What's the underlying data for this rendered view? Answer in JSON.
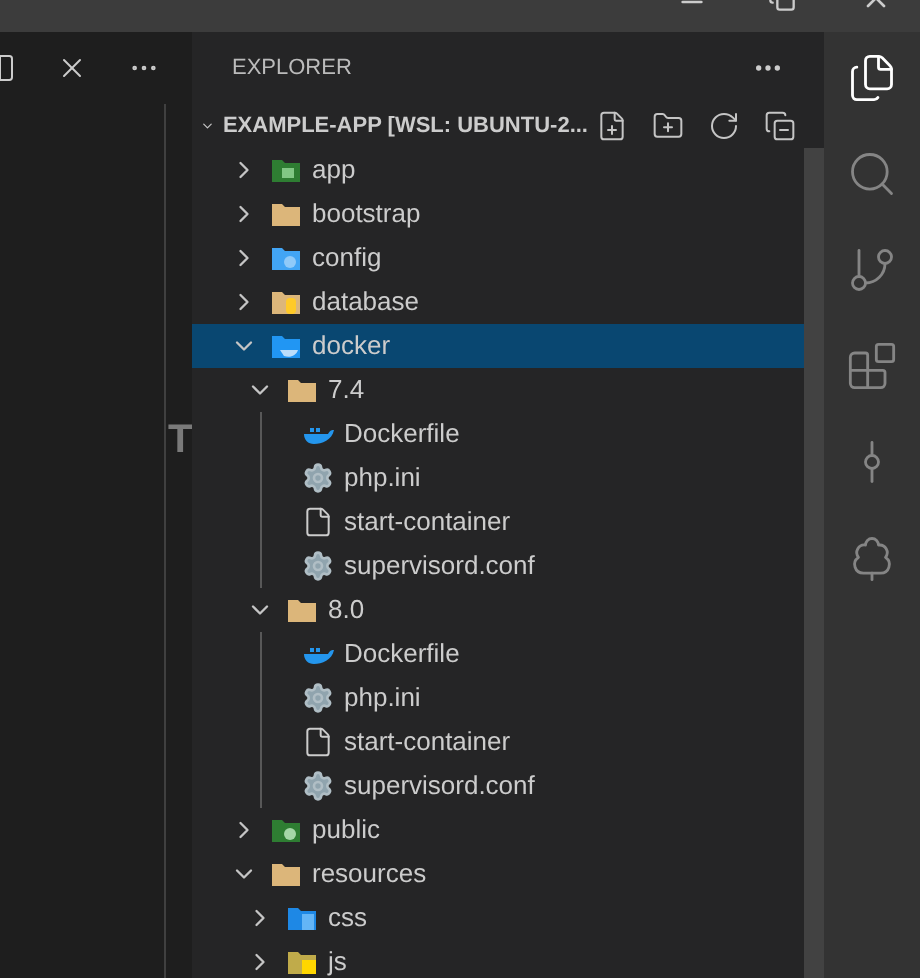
{
  "editor_fragment": "T",
  "explorer": {
    "title": "EXPLORER",
    "root": {
      "label": "EXAMPLE-APP [WSL: UBUNTU-2...",
      "expanded": true
    },
    "tree": [
      {
        "label": "app",
        "kind": "app-folder",
        "expanded": false,
        "selected": false
      },
      {
        "label": "bootstrap",
        "kind": "folder",
        "expanded": false,
        "selected": false
      },
      {
        "label": "config",
        "kind": "config-folder",
        "expanded": false,
        "selected": false
      },
      {
        "label": "database",
        "kind": "database-folder",
        "expanded": false,
        "selected": false
      },
      {
        "label": "docker",
        "kind": "docker-folder",
        "expanded": true,
        "selected": true,
        "children": [
          {
            "label": "7.4",
            "kind": "folder",
            "expanded": true,
            "selected": false,
            "children": [
              {
                "label": "Dockerfile",
                "kind": "docker-file",
                "selected": false
              },
              {
                "label": "php.ini",
                "kind": "settings-file",
                "selected": false
              },
              {
                "label": "start-container",
                "kind": "file",
                "selected": false
              },
              {
                "label": "supervisord.conf",
                "kind": "settings-file",
                "selected": false
              }
            ]
          },
          {
            "label": "8.0",
            "kind": "folder",
            "expanded": true,
            "selected": false,
            "children": [
              {
                "label": "Dockerfile",
                "kind": "docker-file",
                "selected": false
              },
              {
                "label": "php.ini",
                "kind": "settings-file",
                "selected": false
              },
              {
                "label": "start-container",
                "kind": "file",
                "selected": false
              },
              {
                "label": "supervisord.conf",
                "kind": "settings-file",
                "selected": false
              }
            ]
          }
        ]
      },
      {
        "label": "public",
        "kind": "public-folder",
        "expanded": false,
        "selected": false
      },
      {
        "label": "resources",
        "kind": "folder",
        "expanded": true,
        "selected": false,
        "children": [
          {
            "label": "css",
            "kind": "css-folder",
            "expanded": false,
            "selected": false
          },
          {
            "label": "js",
            "kind": "js-folder",
            "expanded": false,
            "selected": false
          }
        ]
      }
    ]
  },
  "activity_bar": [
    {
      "kind": "explorer",
      "selected": true
    },
    {
      "kind": "search",
      "selected": false
    },
    {
      "kind": "source-control",
      "selected": false
    },
    {
      "kind": "extensions",
      "selected": false
    },
    {
      "kind": "remote",
      "selected": false
    },
    {
      "kind": "tree",
      "selected": false
    }
  ]
}
